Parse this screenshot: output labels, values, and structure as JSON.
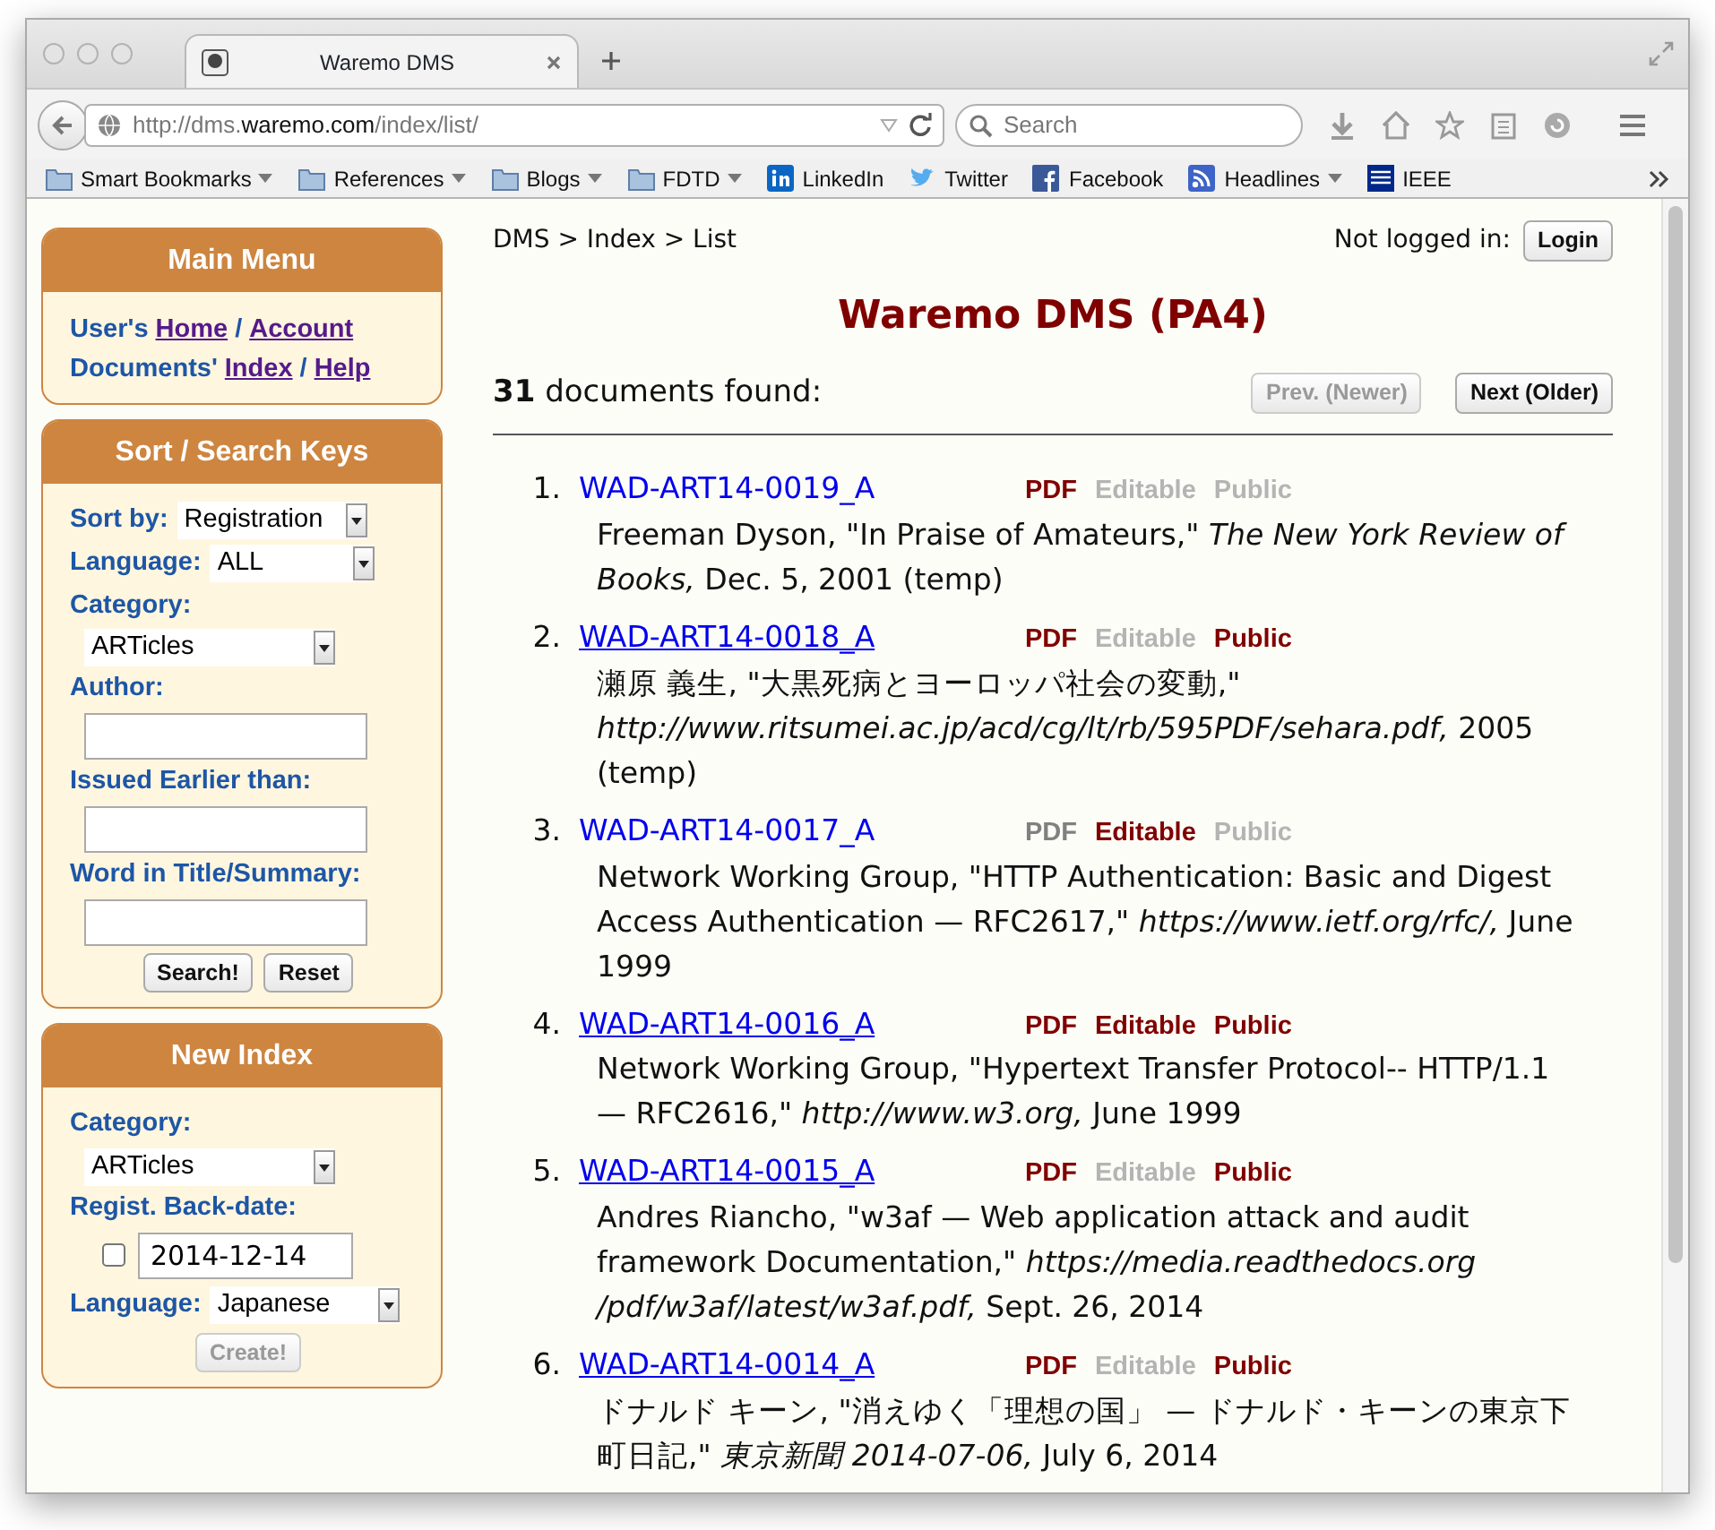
{
  "browser": {
    "tab_title": "Waremo DMS",
    "url": "http://dms.**waremo.com**/index/list/",
    "search_placeholder": "Search",
    "bookmarks": [
      {
        "label": "Smart Bookmarks",
        "kind": "folder",
        "dropdown": true
      },
      {
        "label": "References",
        "kind": "folder",
        "dropdown": true
      },
      {
        "label": "Blogs",
        "kind": "folder",
        "dropdown": true
      },
      {
        "label": "FDTD",
        "kind": "folder",
        "dropdown": true
      },
      {
        "label": "LinkedIn",
        "kind": "linkedin",
        "dropdown": false
      },
      {
        "label": "Twitter",
        "kind": "bird",
        "dropdown": false
      },
      {
        "label": "Facebook",
        "kind": "facebook",
        "dropdown": false
      },
      {
        "label": "Headlines",
        "kind": "feed",
        "dropdown": true
      },
      {
        "label": "IEEE",
        "kind": "ieee",
        "dropdown": false
      }
    ]
  },
  "sidebar": [
    {
      "title": "Main Menu",
      "kind": "menu",
      "lines": [
        [
          {
            "kind": "text",
            "text": "User's"
          },
          {
            "kind": "link",
            "text": "Home"
          },
          {
            "kind": "text",
            "text": "/"
          },
          {
            "kind": "link",
            "text": "Account"
          }
        ],
        [
          {
            "kind": "text",
            "text": "Documents'"
          },
          {
            "kind": "link",
            "text": "Index"
          },
          {
            "kind": "text",
            "text": "/"
          },
          {
            "kind": "link",
            "text": "Help"
          }
        ]
      ]
    },
    {
      "title": "Sort / Search Keys",
      "kind": "form",
      "fields": [
        {
          "kind": "select",
          "label": "Sort by:",
          "value": "Registration",
          "inline": true
        },
        {
          "kind": "select",
          "label": "Language:",
          "value": "ALL",
          "inline": true
        },
        {
          "kind": "select",
          "label": "Category:",
          "value": "ARTicles",
          "inline": false
        },
        {
          "kind": "input",
          "label": "Author:"
        },
        {
          "kind": "input",
          "label": "Issued Earlier than:"
        },
        {
          "kind": "input",
          "label": "Word in Title/Summary:"
        }
      ],
      "buttons": [
        {
          "label": "Search!",
          "disabled": false
        },
        {
          "label": "Reset",
          "disabled": false
        }
      ]
    },
    {
      "title": "New Index",
      "kind": "form",
      "fields": [
        {
          "kind": "select",
          "label": "Category:",
          "value": "ARTicles",
          "inline": false
        },
        {
          "kind": "dated",
          "label": "Regist. Back-date:",
          "checked": false,
          "value": "2014-12-14"
        },
        {
          "kind": "select",
          "label": "Language:",
          "value": "Japanese",
          "inline": true
        }
      ],
      "buttons": [
        {
          "label": "Create!",
          "disabled": true
        }
      ]
    }
  ],
  "main": {
    "breadcrumb": "DMS > Index > List",
    "login_label": "Not logged in:",
    "login_button": "Login",
    "title": "Waremo DMS (PA4)",
    "count": "31",
    "count_label": "documents found:",
    "pager": [
      {
        "label": "Prev. (Newer)",
        "disabled": true
      },
      {
        "label": "Next (Older)",
        "disabled": false
      }
    ],
    "documents": [
      {
        "number": "1.",
        "id": "WAD-ART14-0019_A",
        "underlined": false,
        "flags": [
          {
            "label": "PDF",
            "on": true,
            "muted": false
          },
          {
            "label": "Editable",
            "on": false,
            "muted": false
          },
          {
            "label": "Public",
            "on": false,
            "muted": false
          }
        ],
        "citation": "Freeman Dyson, \"In Praise of Amateurs,\" *The New York Review of Books,* Dec. 5, 2001 (temp)"
      },
      {
        "number": "2.",
        "id": "WAD-ART14-0018_A",
        "underlined": true,
        "flags": [
          {
            "label": "PDF",
            "on": true,
            "muted": false
          },
          {
            "label": "Editable",
            "on": false,
            "muted": false
          },
          {
            "label": "Public",
            "on": true,
            "muted": false
          }
        ],
        "citation": "瀬原 義生, \"大黒死病とヨーロッパ社会の変動,\" *http://www.ritsumei.ac.jp/acd/cg/lt/rb/595PDF/sehara.pdf,* 2005 (temp)"
      },
      {
        "number": "3.",
        "id": "WAD-ART14-0017_A",
        "underlined": false,
        "flags": [
          {
            "label": "PDF",
            "on": false,
            "muted": true
          },
          {
            "label": "Editable",
            "on": true,
            "muted": false
          },
          {
            "label": "Public",
            "on": false,
            "muted": false
          }
        ],
        "citation": "Network Working Group, \"HTTP Authentication: Basic and Digest Access Authentication — RFC2617,\" *https://www.ietf.org/rfc/,* June 1999"
      },
      {
        "number": "4.",
        "id": "WAD-ART14-0016_A",
        "underlined": true,
        "flags": [
          {
            "label": "PDF",
            "on": true,
            "muted": false
          },
          {
            "label": "Editable",
            "on": true,
            "muted": false
          },
          {
            "label": "Public",
            "on": true,
            "muted": false
          }
        ],
        "citation": "Network Working Group, \"Hypertext Transfer Protocol-- HTTP/1.1 — RFC2616,\" *http://www.w3.org,* June 1999"
      },
      {
        "number": "5.",
        "id": "WAD-ART14-0015_A",
        "underlined": true,
        "flags": [
          {
            "label": "PDF",
            "on": true,
            "muted": false
          },
          {
            "label": "Editable",
            "on": false,
            "muted": false
          },
          {
            "label": "Public",
            "on": true,
            "muted": false
          }
        ],
        "citation": "Andres Riancho, \"w3af — Web application attack and audit framework Documentation,\" *https://media.readthedocs.org /pdf/w3af/latest/w3af.pdf,* Sept. 26, 2014"
      },
      {
        "number": "6.",
        "id": "WAD-ART14-0014_A",
        "underlined": true,
        "flags": [
          {
            "label": "PDF",
            "on": true,
            "muted": false
          },
          {
            "label": "Editable",
            "on": false,
            "muted": false
          },
          {
            "label": "Public",
            "on": true,
            "muted": false
          }
        ],
        "citation": "ドナルド キーン, \"消えゆく「理想の国」 — ドナルド・キーンの東京下町日記,\" *東京新聞 2014-07-06,* July 6, 2014"
      }
    ]
  }
}
